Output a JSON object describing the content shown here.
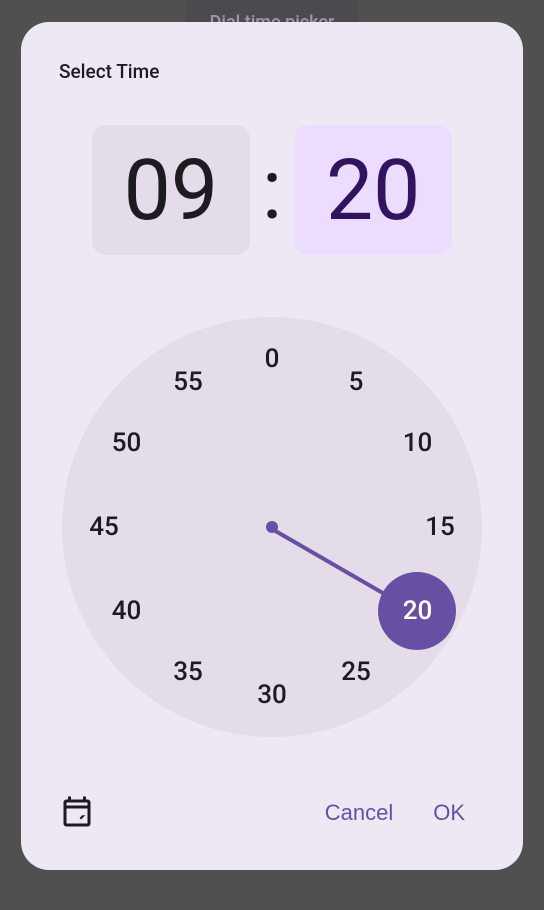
{
  "background": {
    "button_label": "Dial time picker"
  },
  "dialog": {
    "title": "Select Time",
    "hours": "09",
    "minutes": "20",
    "colon": ":",
    "active": "minutes",
    "clock": {
      "selected": "20",
      "labels": [
        "0",
        "5",
        "10",
        "15",
        "20",
        "25",
        "30",
        "35",
        "40",
        "45",
        "50",
        "55"
      ]
    },
    "actions": {
      "cancel": "Cancel",
      "ok": "OK"
    }
  }
}
